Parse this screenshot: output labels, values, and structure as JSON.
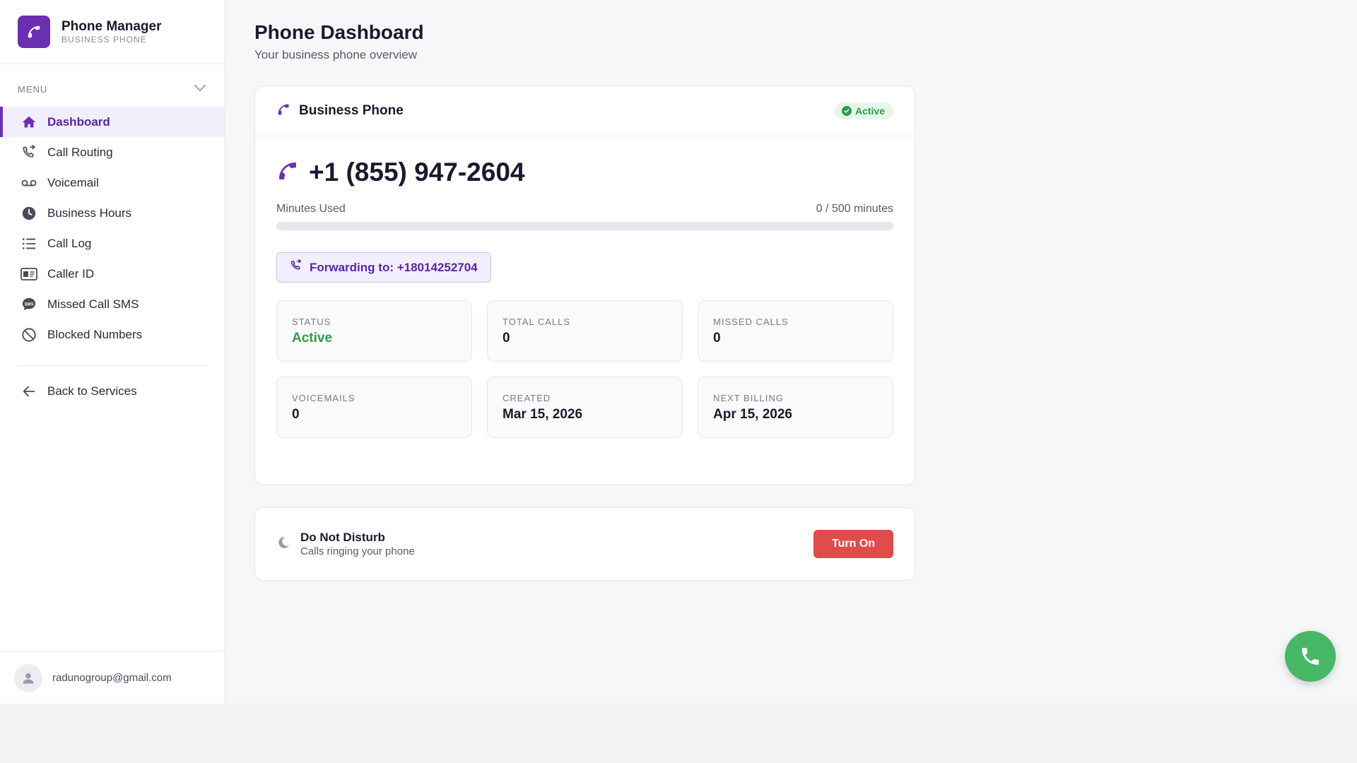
{
  "brand": {
    "name": "Phone Manager",
    "subtitle": "BUSINESS PHONE"
  },
  "sidebar": {
    "menu_title": "MENU",
    "items": [
      {
        "label": "Dashboard",
        "icon": "home-icon",
        "active": true
      },
      {
        "label": "Call Routing",
        "icon": "phone-forward-icon"
      },
      {
        "label": "Voicemail",
        "icon": "voicemail-icon"
      },
      {
        "label": "Business Hours",
        "icon": "clock-icon"
      },
      {
        "label": "Call Log",
        "icon": "list-icon"
      },
      {
        "label": "Caller ID",
        "icon": "id-card-icon"
      },
      {
        "label": "Missed Call SMS",
        "icon": "sms-bubble-icon"
      },
      {
        "label": "Blocked Numbers",
        "icon": "block-icon"
      }
    ],
    "back_label": "Back to Services"
  },
  "user": {
    "email": "radunogroup@gmail.com"
  },
  "page": {
    "title": "Phone Dashboard",
    "subtitle": "Your business phone overview"
  },
  "phone_card": {
    "title": "Business Phone",
    "status_badge": "Active",
    "number": "+1 (855) 947-2604",
    "usage_label": "Minutes Used",
    "usage_value": "0 / 500 minutes",
    "usage_fraction": 0,
    "forwarding": "Forwarding to: +18014252704",
    "stats": [
      {
        "label": "STATUS",
        "value": "Active"
      },
      {
        "label": "TOTAL CALLS",
        "value": "0"
      },
      {
        "label": "MISSED CALLS",
        "value": "0"
      },
      {
        "label": "VOICEMAILS",
        "value": "0"
      },
      {
        "label": "CREATED",
        "value": "Mar 15, 2026"
      },
      {
        "label": "NEXT BILLING",
        "value": "Apr 15, 2026"
      }
    ]
  },
  "dnd": {
    "title": "Do Not Disturb",
    "subtitle": "Calls ringing your phone",
    "button": "Turn On"
  },
  "colors": {
    "accent": "#6b2fb3",
    "success": "#2e9e48",
    "danger": "#e04b4b",
    "fab": "#47b866"
  }
}
